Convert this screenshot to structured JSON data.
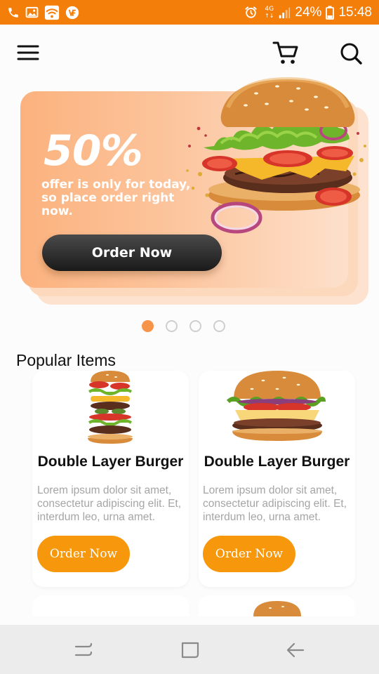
{
  "status_bar": {
    "time": "15:48",
    "battery": "24%",
    "network": "4G",
    "left_icons": [
      "phone-icon",
      "image-icon",
      "wifi-notification-icon",
      "brand-notification-icon"
    ],
    "right_icons": [
      "alarm-icon",
      "signal-icon",
      "battery-icon"
    ]
  },
  "app_bar": {
    "icons": [
      "menu-icon",
      "cart-icon",
      "search-icon"
    ]
  },
  "banner": {
    "headline": "50%",
    "subtext": "offer is only for today, so place order right now.",
    "button_label": "Order Now",
    "colors": {
      "gradient_start": "#fbb27e",
      "gradient_end": "#fde0cb",
      "button": "#2a2a2a"
    }
  },
  "carousel": {
    "pages": 4,
    "active_index": 0,
    "active_color": "#f6954a"
  },
  "popular": {
    "title": "Popular Items",
    "items": [
      {
        "name": "Double Layer Burger",
        "description": "Lorem ipsum dolor sit amet, consectetur adipiscing elit. Et, interdum leo, urna amet.",
        "button_label": "Order Now"
      },
      {
        "name": "Double Layer Burger",
        "description": "Lorem ipsum dolor sit amet, consectetur adipiscing elit. Et, interdum leo, urna amet.",
        "button_label": "Order Now"
      }
    ],
    "accent_color": "#f7980c"
  },
  "nav_bar": {
    "icons": [
      "recents-icon",
      "home-icon",
      "back-icon"
    ]
  }
}
